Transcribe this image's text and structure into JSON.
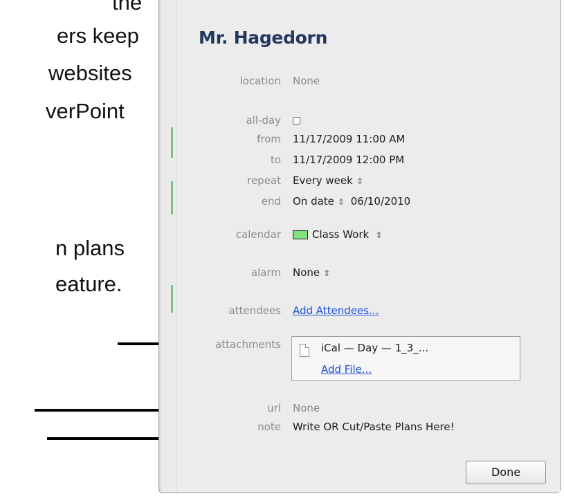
{
  "slide": {
    "lines": [
      "the",
      "ers keep",
      "websites",
      "verPoint",
      "n plans",
      "eature."
    ]
  },
  "event": {
    "title": "Mr. Hagedorn",
    "location_label": "location",
    "location_value": "None",
    "allday_label": "all-day",
    "from_label": "from",
    "from_value": "11/17/2009 11:00 AM",
    "to_label": "to",
    "to_value": "11/17/2009 12:00 PM",
    "repeat_label": "repeat",
    "repeat_value": "Every week",
    "end_label": "end",
    "end_mode": "On date",
    "end_date": "06/10/2010",
    "calendar_label": "calendar",
    "calendar_value": "Class Work",
    "calendar_color": "#7ee37e",
    "alarm_label": "alarm",
    "alarm_value": "None",
    "attendees_label": "attendees",
    "attendees_link": "Add Attendees...",
    "attachments_label": "attachments",
    "attachment_name": "iCal — Day — 1_3_...",
    "add_file_link": "Add File...",
    "url_label": "url",
    "url_value": "None",
    "note_label": "note",
    "note_value": "Write OR Cut/Paste Plans Here!",
    "done_label": "Done",
    "stepper_glyph": "⇕"
  }
}
